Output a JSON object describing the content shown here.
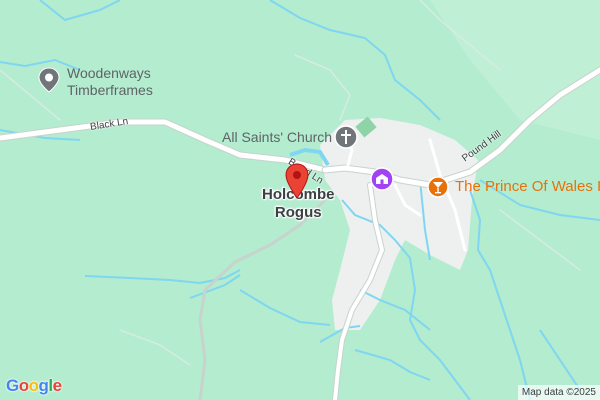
{
  "map": {
    "places": {
      "village_line1": "Holcombe",
      "village_line2": "Rogus"
    },
    "pois": {
      "timberframes_line1": "Woodenways",
      "timberframes_line2": "Timberframes",
      "church": "All Saints' Church",
      "pub": "The Prince Of Wales Inn"
    },
    "roads": {
      "black_ln": "Black Ln",
      "pound_hill": "Pound Hill",
      "bowd_ln": "Bowd Ln"
    },
    "attribution": "Map data ©2025",
    "logo_letters": [
      "G",
      "o",
      "o",
      "g",
      "l",
      "e"
    ],
    "colors": {
      "land": "#b3eccf",
      "water": "#7fd6f0",
      "road": "#ffffff",
      "road_outline": "#c7d3cc",
      "settlement": "#eef0f0",
      "pin": "#ea4335",
      "pub_orange": "#e8710a",
      "tourist_purple": "#a142f4",
      "church_gray": "#70757a"
    }
  }
}
